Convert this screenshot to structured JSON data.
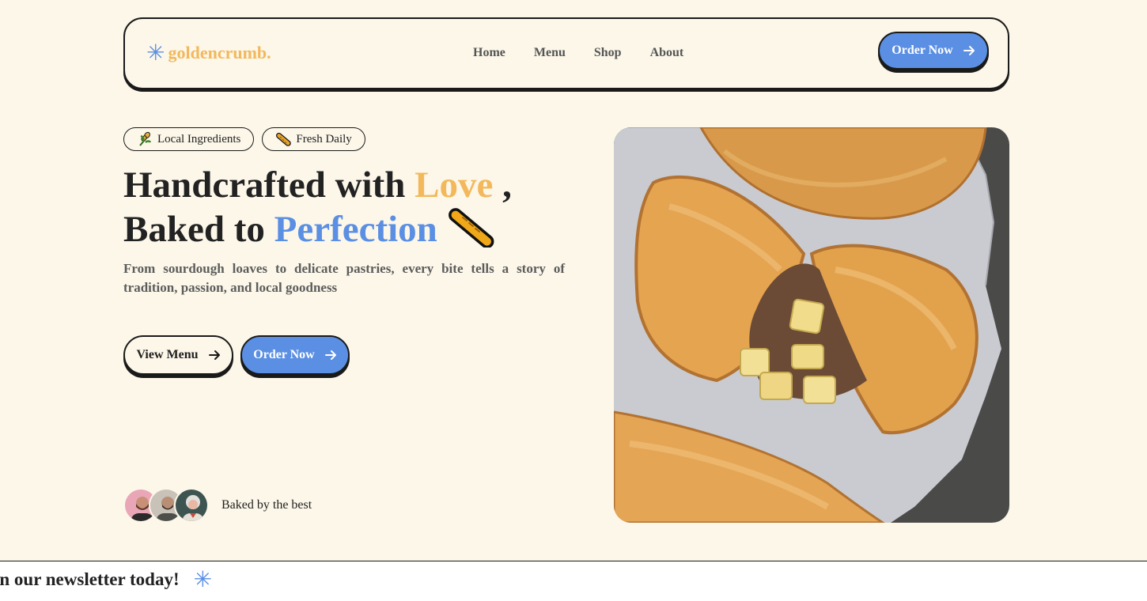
{
  "brand": {
    "name": "goldencrumb.",
    "logo_icon": "asterisk-icon"
  },
  "nav": {
    "items": [
      {
        "label": "Home"
      },
      {
        "label": "Menu"
      },
      {
        "label": "Shop"
      },
      {
        "label": "About"
      }
    ]
  },
  "header": {
    "cta_label": "Order Now"
  },
  "hero": {
    "tags": [
      {
        "label": "Local Ingredients",
        "icon": "wheat-icon"
      },
      {
        "label": "Fresh Daily",
        "icon": "baguette-icon"
      }
    ],
    "headline": {
      "line1_prefix": "Handcrafted with ",
      "line1_highlight": "Love",
      "line1_suffix": " ,",
      "line2_prefix": "Baked to ",
      "line2_highlight": "Perfection"
    },
    "subtitle": "From sourdough loaves to delicate pastries, every bite tells a story of tradition, passion, and local goodness",
    "buttons": {
      "secondary": "View Menu",
      "primary": "Order Now"
    },
    "social_proof": "Baked by the best",
    "image_subject": "pasties-photo"
  },
  "marquee": {
    "text": "Join our newsletter today!"
  },
  "colors": {
    "background": "#fcf7e9",
    "accent_blue": "#5b8fe3",
    "accent_gold": "#f3b85c",
    "ink": "#1a1a1a"
  }
}
